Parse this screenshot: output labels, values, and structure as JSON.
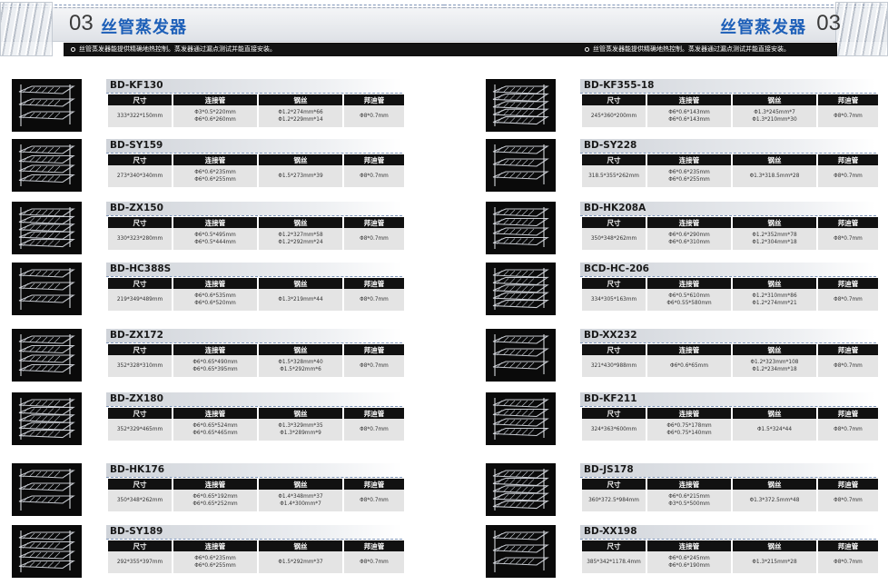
{
  "header": {
    "left": {
      "section_number": "03",
      "title": "丝管蒸发器",
      "note": "丝管蒸发器能提供精确地热控制。蒸发器通过漏点测试并能直接安装。"
    },
    "right": {
      "section_number": "03",
      "title": "丝管蒸发器",
      "note": "丝管蒸发器能提供精确地热控制。蒸发器通过漏点测试并能直接安装。"
    }
  },
  "table_headers": [
    "尺寸",
    "连接管",
    "钢丝",
    "邦迪管"
  ],
  "products": [
    {
      "model": "BD-KF130",
      "size": "333*322*150mm",
      "connector": [
        "Φ3*0.5*220mm",
        "Φ6*0.6*260mm"
      ],
      "wire": [
        "Φ1.2*274mm*66",
        "Φ1.2*229mm*14"
      ],
      "bundy": "Φ8*0.7mm"
    },
    {
      "model": "BD-SY159",
      "size": "273*340*340mm",
      "connector": [
        "Φ6*0.6*235mm",
        "Φ6*0.6*255mm"
      ],
      "wire": [
        "Φ1.5*273mm*39"
      ],
      "bundy": "Φ8*0.7mm"
    },
    {
      "model": "BD-ZX150",
      "size": "330*323*280mm",
      "connector": [
        "Φ6*0.5*495mm",
        "Φ6*0.5*444mm"
      ],
      "wire": [
        "Φ1.2*327mm*58",
        "Φ1.2*292mm*24"
      ],
      "bundy": "Φ8*0.7mm"
    },
    {
      "model": "BD-HC388S",
      "size": "219*349*489mm",
      "connector": [
        "Φ6*0.6*535mm",
        "Φ6*0.6*520mm"
      ],
      "wire": [
        "Φ1.3*219mm*44"
      ],
      "bundy": "Φ8*0.7mm"
    },
    {
      "model": "BD-ZX172",
      "size": "352*328*310mm",
      "connector": [
        "Φ6*0.65*490mm",
        "Φ6*0.65*395mm"
      ],
      "wire": [
        "Φ1.5*328mm*40",
        "Φ1.5*292mm*6"
      ],
      "bundy": "Φ8*0.7mm"
    },
    {
      "model": "BD-ZX180",
      "size": "352*329*465mm",
      "connector": [
        "Φ6*0.65*524mm",
        "Φ6*0.65*465mm"
      ],
      "wire": [
        "Φ1.3*329mm*35",
        "Φ1.3*289mm*9"
      ],
      "bundy": "Φ8*0.7mm"
    },
    {
      "model": "BD-HK176",
      "size": "350*348*262mm",
      "connector": [
        "Φ6*0.65*192mm",
        "Φ6*0.65*252mm"
      ],
      "wire": [
        "Φ1.4*348mm*37",
        "Φ1.4*300mm*7"
      ],
      "bundy": "Φ8*0.7mm"
    },
    {
      "model": "BD-SY189",
      "size": "292*355*397mm",
      "connector": [
        "Φ6*0.6*235mm",
        "Φ6*0.6*255mm"
      ],
      "wire": [
        "Φ1.5*292mm*37"
      ],
      "bundy": "Φ8*0.7mm"
    },
    {
      "model": "BD-KF355-18",
      "size": "245*360*200mm",
      "connector": [
        "Φ6*0.6*143mm",
        "Φ6*0.6*143mm"
      ],
      "wire": [
        "Φ1.3*245mm*7",
        "Φ1.3*210mm*30"
      ],
      "bundy": "Φ8*0.7mm"
    },
    {
      "model": "BD-SY228",
      "size": "318.5*355*262mm",
      "connector": [
        "Φ6*0.6*235mm",
        "Φ6*0.6*255mm"
      ],
      "wire": [
        "Φ1.3*318.5mm*28"
      ],
      "bundy": "Φ8*0.7mm"
    },
    {
      "model": "BD-HK208A",
      "size": "350*348*262mm",
      "connector": [
        "Φ6*0.6*290mm",
        "Φ6*0.6*310mm"
      ],
      "wire": [
        "Φ1.2*352mm*78",
        "Φ1.2*304mm*18"
      ],
      "bundy": "Φ8*0.7mm"
    },
    {
      "model": "BCD-HC-206",
      "size": "334*305*163mm",
      "connector": [
        "Φ6*0.5*610mm",
        "Φ6*0.55*580mm"
      ],
      "wire": [
        "Φ1.2*310mm*86",
        "Φ1.2*274mm*21"
      ],
      "bundy": "Φ8*0.7mm"
    },
    {
      "model": "BD-XX232",
      "size": "321*430*988mm",
      "connector": [
        "Φ6*0.6*65mm"
      ],
      "wire": [
        "Φ1.2*323mm*108",
        "Φ1.2*234mm*18"
      ],
      "bundy": "Φ8*0.7mm"
    },
    {
      "model": "BD-KF211",
      "size": "324*363*600mm",
      "connector": [
        "Φ6*0.75*178mm",
        "Φ6*0.75*140mm"
      ],
      "wire": [
        "Φ1.5*324*44"
      ],
      "bundy": "Φ8*0.7mm"
    },
    {
      "model": "BD-JS178",
      "size": "360*372.5*984mm",
      "connector": [
        "Φ6*0.6*215mm",
        "Φ3*0.5*500mm"
      ],
      "wire": [
        "Φ1.3*372.5mm*48"
      ],
      "bundy": "Φ8*0.7mm"
    },
    {
      "model": "BD-XX198",
      "size": "385*342*1178.4mm",
      "connector": [
        "Φ6*0.6*245mm",
        "Φ6*0.6*190mm"
      ],
      "wire": [
        "Φ1.3*215mm*28"
      ],
      "bundy": "Φ8*0.7mm"
    }
  ]
}
